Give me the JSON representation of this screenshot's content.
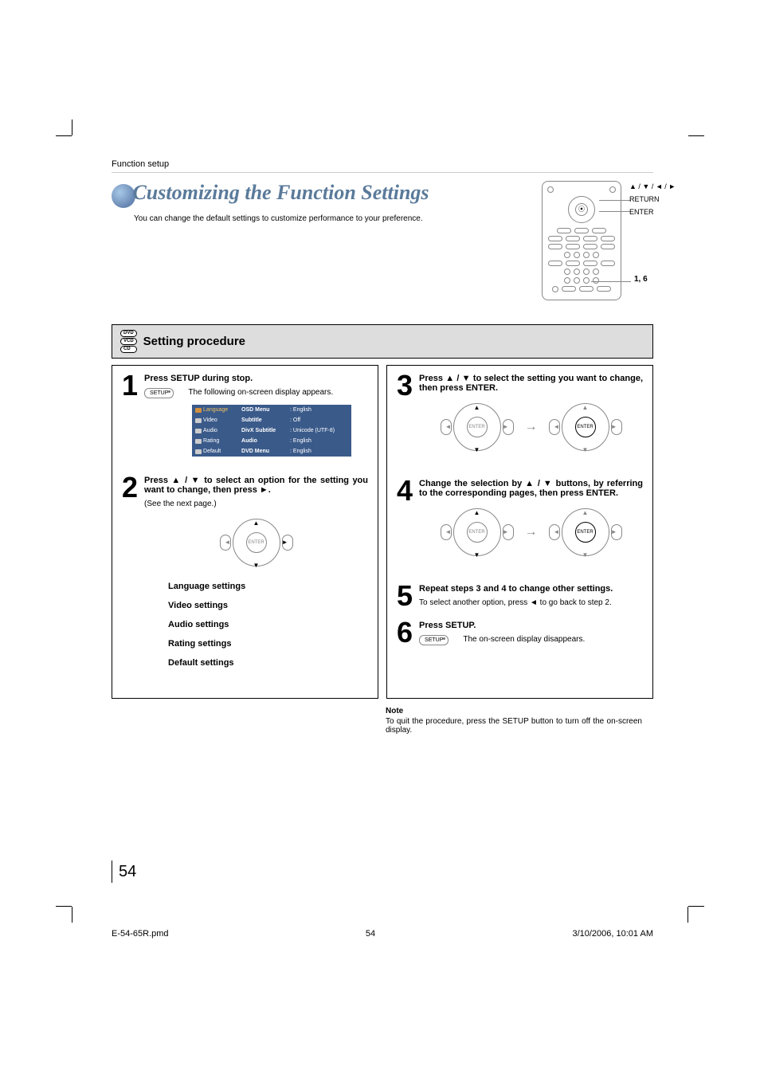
{
  "breadcrumb": "Function setup",
  "title": "Customizing the Function Settings",
  "subtitle": "You can change the default settings to customize performance to your preference.",
  "remote": {
    "nav_label": "▲ / ▼ / ◄ / ►",
    "return": "RETURN",
    "enter": "ENTER",
    "steps_label": "1, 6"
  },
  "section_title": "Setting procedure",
  "disc_badges": [
    "DVD",
    "VCD",
    "CD"
  ],
  "steps": {
    "s1": {
      "num": "1",
      "head": "Press SETUP during stop.",
      "btn": "SETUP",
      "text": "The following on-screen display appears."
    },
    "s2": {
      "num": "2",
      "head": "Press ▲ / ▼ to select an option for the setting you want to change, then press ►.",
      "see_next": "(See the next page.)"
    },
    "s3": {
      "num": "3",
      "head": "Press ▲ / ▼ to select the setting you want to change, then press ENTER."
    },
    "s4": {
      "num": "4",
      "head": "Change the selection by ▲ / ▼ buttons, by referring to the corresponding pages, then press ENTER."
    },
    "s5": {
      "num": "5",
      "head": "Repeat steps 3 and 4 to change other settings.",
      "text": "To select another option, press ◄ to go back to step 2."
    },
    "s6": {
      "num": "6",
      "head": "Press SETUP.",
      "btn": "SETUP",
      "text": "The on-screen display disappears."
    }
  },
  "osd": {
    "tabs": [
      "Language",
      "Video",
      "Audio",
      "Rating",
      "Default"
    ],
    "rows": [
      {
        "label": "OSD Menu",
        "val": ": English"
      },
      {
        "label": "Subtitle",
        "val": ": Off"
      },
      {
        "label": "DivX Subtitle",
        "val": ": Unicode (UTF-8)"
      },
      {
        "label": "Audio",
        "val": ": English"
      },
      {
        "label": "DVD Menu",
        "val": ": English"
      }
    ]
  },
  "settings_list": [
    "Language settings",
    "Video settings",
    "Audio settings",
    "Rating settings",
    "Default settings"
  ],
  "dpad_enter": "ENTER",
  "note": {
    "title": "Note",
    "text": "To quit the procedure, press the SETUP button to turn off the on-screen display."
  },
  "page_number": "54",
  "footer": {
    "file": "E-54-65R.pmd",
    "page": "54",
    "timestamp": "3/10/2006, 10:01 AM"
  }
}
